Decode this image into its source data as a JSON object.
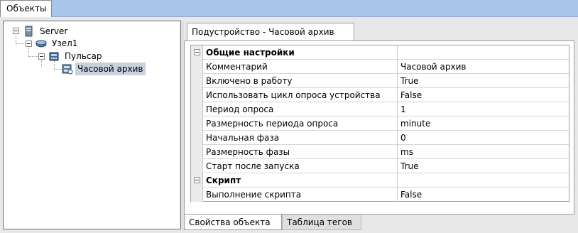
{
  "top_tab": {
    "label": "Объекты"
  },
  "tree": {
    "nodes": [
      {
        "label": "Server",
        "icon": "server-icon"
      },
      {
        "label": "Узел1",
        "icon": "node-icon"
      },
      {
        "label": "Пульсар",
        "icon": "device-icon"
      },
      {
        "label": "Часовой архив",
        "icon": "archive-icon",
        "selected": true
      }
    ]
  },
  "properties_tab": {
    "label": "Подустройство - Часовой архив"
  },
  "grid": {
    "rows": [
      {
        "name": "Общие настройки",
        "value": "",
        "section": true
      },
      {
        "name": "Комментарий",
        "value": "Часовой архив"
      },
      {
        "name": "Включено в работу",
        "value": "True"
      },
      {
        "name": "Использовать цикл опроса устройства",
        "value": "False"
      },
      {
        "name": "Период опроса",
        "value": "1"
      },
      {
        "name": "Размерность периода опроса",
        "value": "minute"
      },
      {
        "name": "Начальная фаза",
        "value": "0"
      },
      {
        "name": "Размерность фазы",
        "value": "ms"
      },
      {
        "name": "Старт после запуска",
        "value": "True"
      },
      {
        "name": "Скрипт",
        "value": "",
        "section": true
      },
      {
        "name": "Выполнение скрипта",
        "value": "False"
      }
    ]
  },
  "bottom_tabs": [
    {
      "label": "Свойства объекта",
      "active": true
    },
    {
      "label": "Таблица тегов",
      "active": false
    }
  ],
  "colors": {
    "title_bar": "#a8c5ea",
    "selection": "#c8d2de",
    "background": "#e8e8e8"
  }
}
